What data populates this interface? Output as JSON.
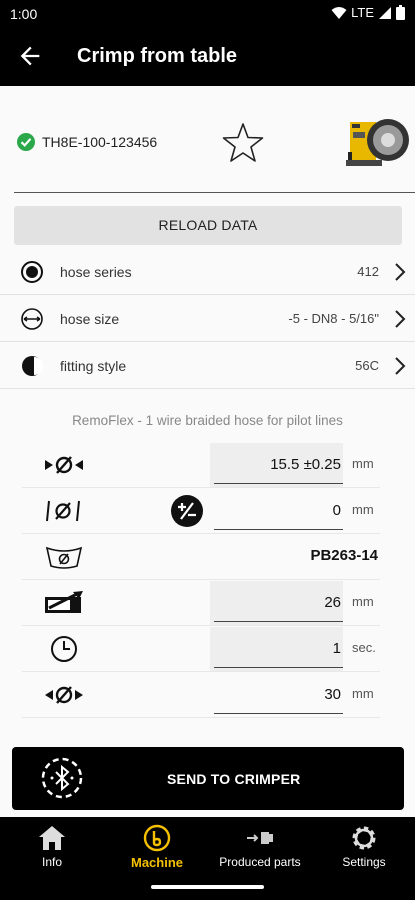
{
  "status_bar": {
    "time": "1:00",
    "network": "LTE"
  },
  "app_bar": {
    "title": "Crimp from table"
  },
  "device": {
    "serial": "TH8E-100-123456"
  },
  "reload_label": "RELOAD DATA",
  "selectors": [
    {
      "label": "hose series",
      "value": "412"
    },
    {
      "label": "hose size",
      "value": "-5 - DN8 - 5/16\""
    },
    {
      "label": "fitting style",
      "value": "56C"
    }
  ],
  "description": "RemoFlex - 1 wire braided hose for pilot lines",
  "params": {
    "crimp_diameter": {
      "value": "15.5 ±0.25",
      "unit": "mm"
    },
    "correction": {
      "value": "0",
      "unit": "mm"
    },
    "die_set": {
      "value": "PB263-14"
    },
    "insertion_depth": {
      "value": "26",
      "unit": "mm"
    },
    "time": {
      "value": "1",
      "unit": "sec."
    },
    "open_diameter": {
      "value": "30",
      "unit": "mm"
    }
  },
  "send_label": "SEND TO CRIMPER",
  "bottom_nav": [
    {
      "label": "Info",
      "icon": "home-icon"
    },
    {
      "label": "Machine",
      "icon": "machine-icon",
      "active": true
    },
    {
      "label": "Produced parts",
      "icon": "produced-parts-icon"
    },
    {
      "label": "Settings",
      "icon": "gear-icon"
    }
  ],
  "colors": {
    "accent": "#f5c000",
    "ok": "#2aa84a",
    "bar": "#000000"
  }
}
